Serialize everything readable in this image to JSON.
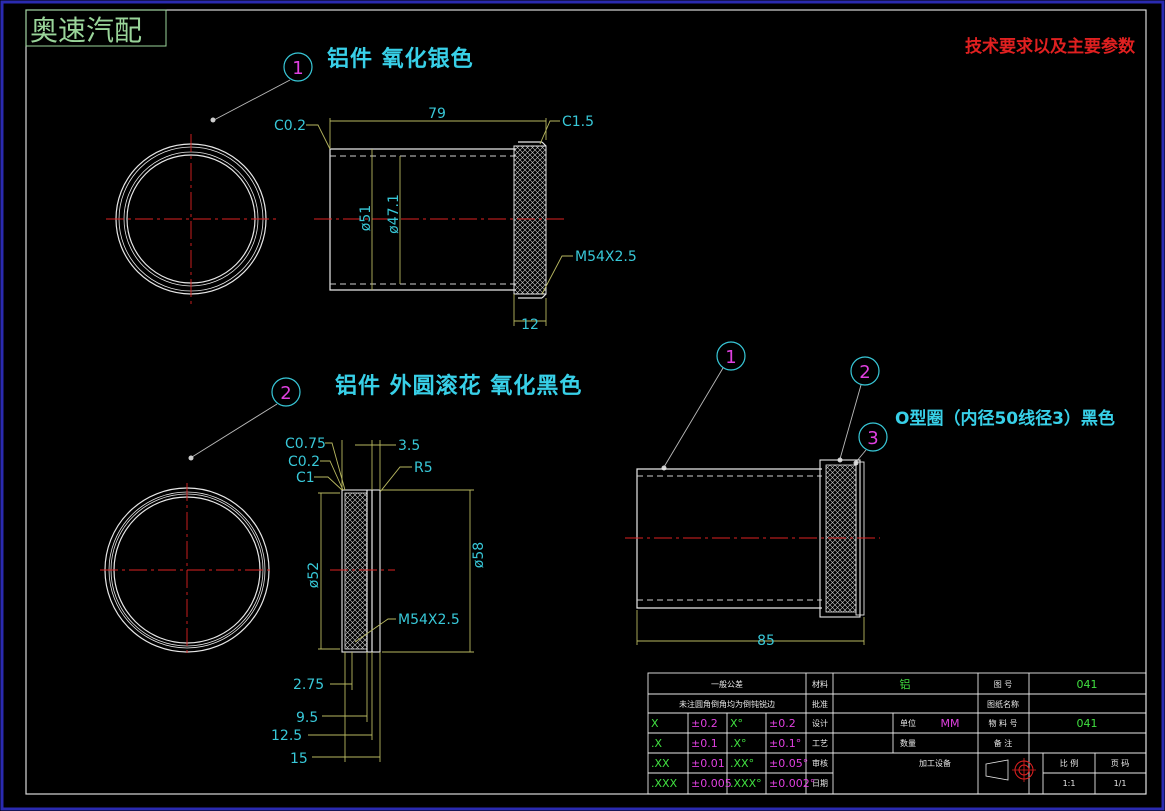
{
  "watermark": "奥速汽配",
  "tech_requirements": "技术要求以及主要参数",
  "part1": {
    "bubble": "1",
    "label": "铝件 氧化银色",
    "dims": {
      "length": "79",
      "chamfer_left": "C0.2",
      "chamfer_right": "C1.5",
      "outer_dia": "ø51",
      "inner_dia": "ø47.1",
      "thread": "M54X2.5",
      "thread_len": "12"
    }
  },
  "part2": {
    "bubble": "2",
    "label": "铝件 外圆滚花 氧化黑色",
    "dims": {
      "c075": "C0.75",
      "c02": "C0.2",
      "c1": "C1",
      "w35": "3.5",
      "r5": "R5",
      "inner_dia": "ø52",
      "outer_dia": "ø58",
      "thread": "M54X2.5",
      "d275": "2.75",
      "d95": "9.5",
      "d125": "12.5",
      "d15": "15"
    }
  },
  "assembly": {
    "bubble1": "1",
    "bubble2": "2",
    "bubble3": "3",
    "oring_label": "O型圈（内径50线径3）黑色",
    "length": "85"
  },
  "title_block": {
    "general_tol": "一般公差",
    "note": "未注圆角倒角均为倒钝锐边",
    "material_label": "材料",
    "material_value": "铝",
    "drawing_no_label": "图 号",
    "drawing_no": "041",
    "approver_label": "批准",
    "drawing_name_label": "图纸名称",
    "design_label": "设计",
    "unit_label": "单位",
    "unit_value": "MM",
    "item_no_label": "物 料 号",
    "item_no": "041",
    "craft_label": "工艺",
    "qty_label": "数量",
    "remark_label": "备 注",
    "review_label": "审核",
    "process_label": "加工设备",
    "date_label": "日期",
    "scale_label": "比 例",
    "page_label": "页 码",
    "scale": "1:1",
    "page": "1/1",
    "tolerances": [
      {
        "k": "X",
        "v": "±0.2",
        "k2": "X°",
        "v2": "±0.2"
      },
      {
        "k": ".X",
        "v": "±0.1",
        "k2": ".X°",
        "v2": "±0.1°"
      },
      {
        "k": ".XX",
        "v": "±0.01",
        "k2": ".XX°",
        "v2": "±0.05°"
      },
      {
        "k": ".XXX",
        "v": "±0.005",
        "k2": ".XXX°",
        "v2": "±0.002°"
      }
    ]
  }
}
